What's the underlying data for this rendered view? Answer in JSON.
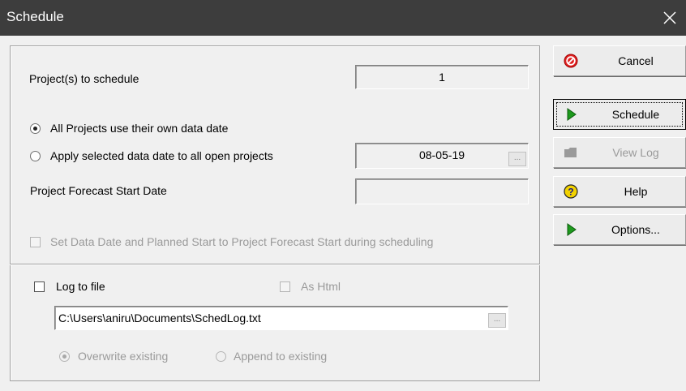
{
  "window": {
    "title": "Schedule"
  },
  "form": {
    "projects_label": "Project(s) to schedule",
    "projects_count": "1",
    "radio_own_date": "All Projects use their own data date",
    "radio_apply_date": "Apply selected data date to all open projects",
    "data_date": "08-05-19",
    "forecast_label": "Project Forecast Start Date",
    "forecast_value": "",
    "set_data_date_label": "Set Data Date and Planned Start to Project Forecast Start during scheduling",
    "log_to_file_label": "Log to file",
    "as_html_label": "As Html",
    "log_path": "C:\\Users\\aniru\\Documents\\SchedLog.txt",
    "overwrite_label": "Overwrite existing",
    "append_label": "Append to existing",
    "ellipsis": "..."
  },
  "buttons": {
    "cancel": "Cancel",
    "schedule": "Schedule",
    "view_log": "View Log",
    "help": "Help",
    "options": "Options..."
  },
  "icons": {
    "cancel": "red-no-entry-icon",
    "schedule": "green-play-icon",
    "view_log": "log-folder-icon",
    "help": "yellow-question-icon",
    "options": "green-play-icon"
  },
  "colors": {
    "titlebar": "#3d3d3d",
    "cancel_icon": "#e02020",
    "play_icon": "#1e9a1e",
    "help_icon": "#f2d200"
  }
}
